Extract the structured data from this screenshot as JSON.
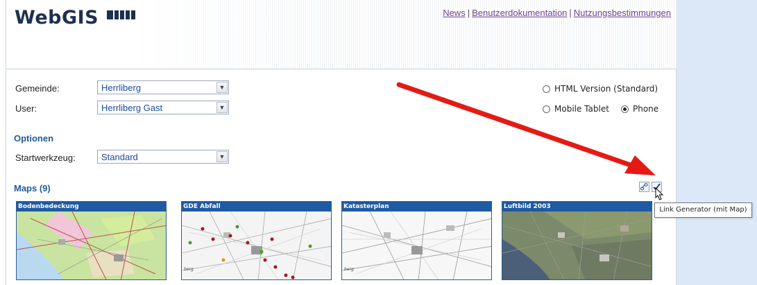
{
  "header": {
    "logo_text": "WebGIS",
    "links": [
      "News",
      "Benutzerdokumentation",
      "Nutzungsbestimmungen"
    ],
    "link_separator": "|"
  },
  "form": {
    "gemeinde_label": "Gemeinde:",
    "gemeinde_value": "Herrliberg",
    "user_label": "User:",
    "user_value": "Herrliberg Gast",
    "options_title": "Optionen",
    "startwerkzeug_label": "Startwerkzeug:",
    "startwerkzeug_value": "Standard"
  },
  "version_options": {
    "html_label": "HTML Version (Standard)",
    "html_checked": false,
    "tablet_label": "Mobile Tablet",
    "tablet_checked": false,
    "phone_label": "Phone",
    "phone_checked": true
  },
  "maps": {
    "title": "Maps (9)",
    "items": [
      {
        "title": "Bodenbedeckung"
      },
      {
        "title": "GDE Abfall"
      },
      {
        "title": "Katasterplan"
      },
      {
        "title": "Luftbild 2003"
      }
    ],
    "thumb_label": "berg"
  },
  "tooltip": "Link Generator (mit Map)",
  "colors": {
    "accent": "#1f5aa3",
    "section_title": "#1f5b9e",
    "link": "#6a3f9a",
    "annotation_arrow": "#e31b14",
    "side_panel": "#dce8f7"
  },
  "icons": [
    "link-icon",
    "check-icon",
    "dropdown-arrow-icon",
    "cursor-icon",
    "red-annotation-arrow"
  ]
}
